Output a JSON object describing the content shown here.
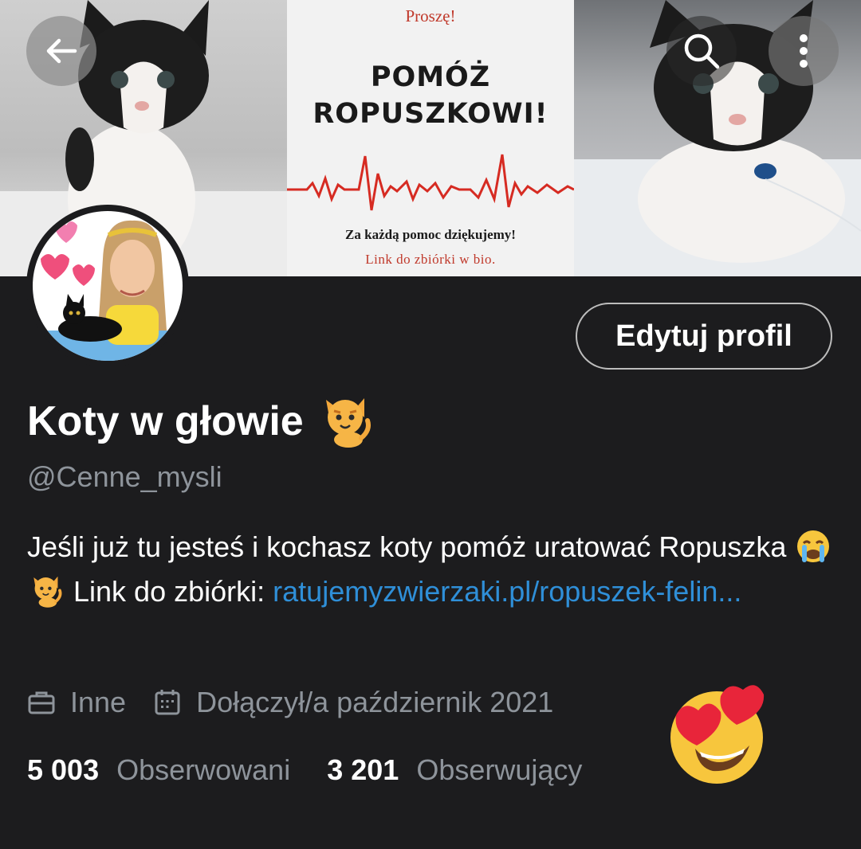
{
  "banner": {
    "poster_top": "Proszę!",
    "poster_title_line1": "POMÓŻ",
    "poster_title_line2": "ROPUSZKOWI!",
    "poster_thanks": "Za każdą pomoc dziękujemy!",
    "poster_link": "Link do zbiórki w bio."
  },
  "nav": {
    "back_icon": "arrow-left-icon",
    "search_icon": "search-icon",
    "more_icon": "more-vertical-icon"
  },
  "profile": {
    "edit_label": "Edytuj profil",
    "name": "Koty w głowie",
    "name_emoji": "cat-emoji",
    "handle": "@Cenne_mysli",
    "bio_text_1": "Jeśli już tu jesteś i kochasz koty pomóż uratować Ropuszka",
    "bio_text_2": "Link do zbiórki:",
    "bio_link": "ratujemyzwierzaki.pl/ropuszek-felin...",
    "category": "Inne",
    "joined": "Dołączył/a październik 2021"
  },
  "stats": {
    "following_count": "5 003",
    "following_label": "Obserwowani",
    "followers_count": "3 201",
    "followers_label": "Obserwujący"
  },
  "colors": {
    "background": "#1c1c1e",
    "link": "#2f8fd8",
    "muted": "#8e949b",
    "poster_red": "#c0392b"
  }
}
